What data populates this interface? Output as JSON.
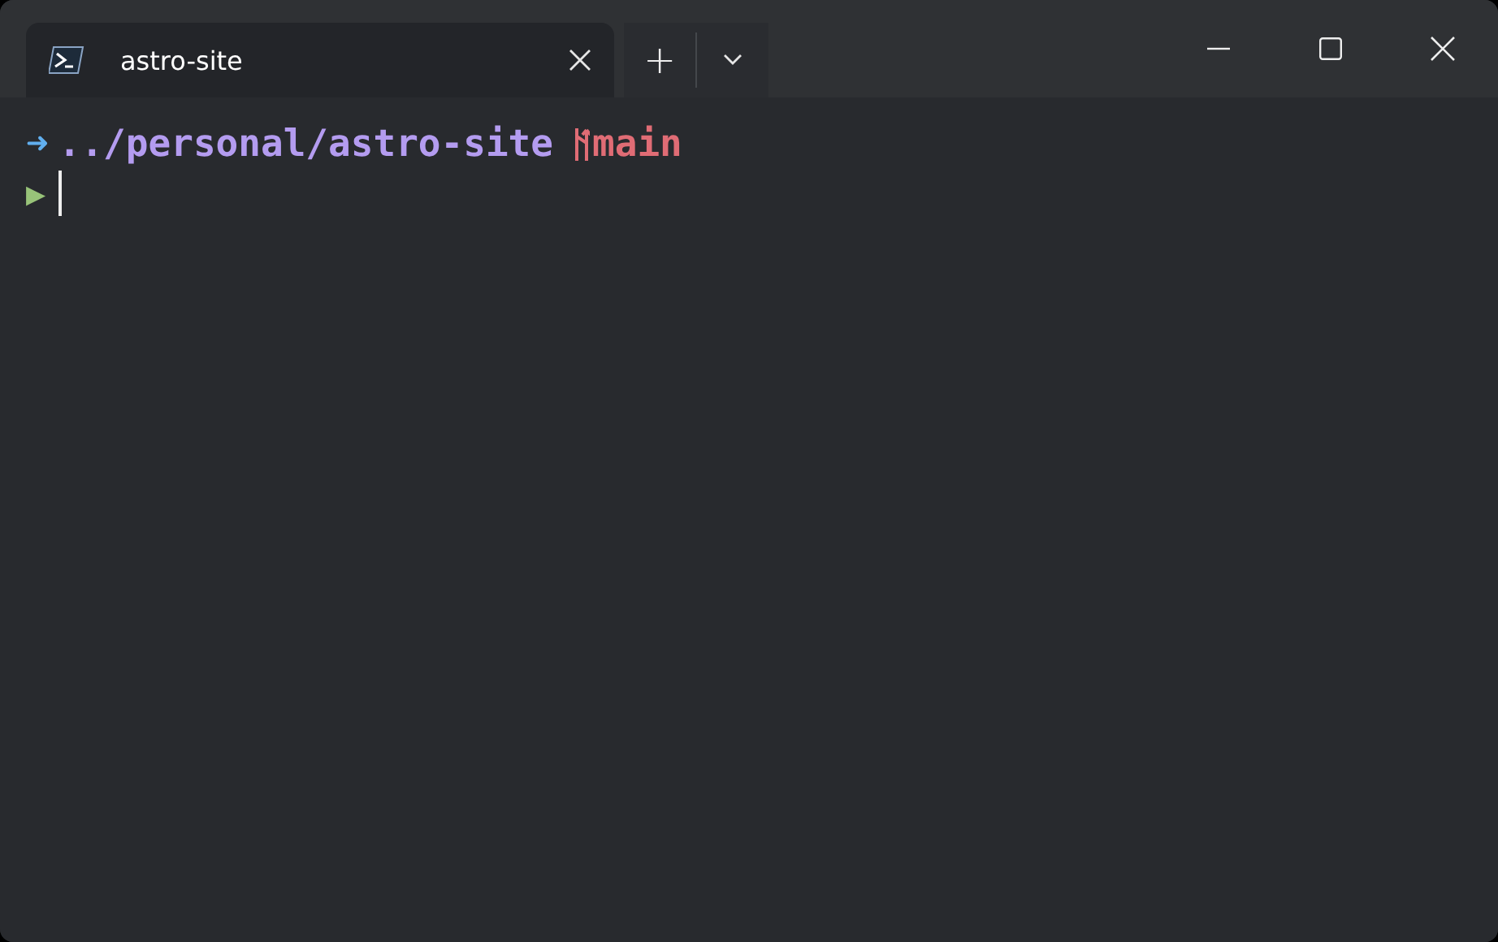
{
  "tabs": [
    {
      "label": "astro-site",
      "selected": true
    }
  ],
  "tab_actions": {
    "new_tab": "+"
  },
  "terminal": {
    "prompt_arrow": "➜",
    "path": "../personal/astro-site",
    "branch": "main",
    "input_marker": "▶"
  }
}
